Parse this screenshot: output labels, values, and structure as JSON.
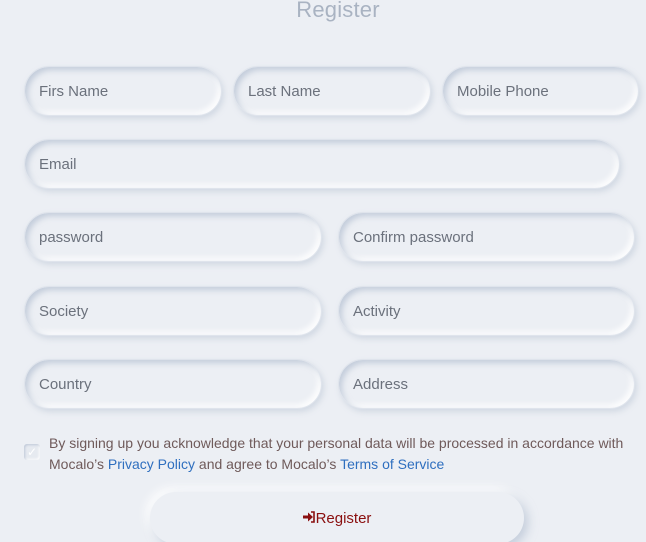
{
  "form": {
    "title": "Register",
    "fields": {
      "first_name": {
        "placeholder": "Firs Name",
        "value": ""
      },
      "last_name": {
        "placeholder": "Last Name",
        "value": ""
      },
      "mobile_phone": {
        "placeholder": "Mobile Phone",
        "value": ""
      },
      "email": {
        "placeholder": "Email",
        "value": ""
      },
      "password": {
        "placeholder": "password",
        "value": ""
      },
      "confirm_password": {
        "placeholder": "Confirm password",
        "value": ""
      },
      "society": {
        "placeholder": "Society",
        "value": ""
      },
      "activity": {
        "placeholder": "Activity",
        "value": ""
      },
      "country": {
        "placeholder": "Country",
        "value": ""
      },
      "address": {
        "placeholder": "Address",
        "value": ""
      }
    },
    "consent": {
      "text_before": "By signing up you acknowledge that your personal data will be processed in accordance with Mocalo’s ",
      "privacy_link": "Privacy Policy",
      "text_middle": " and agree to Mocalo’s ",
      "terms_link": "Terms of Service",
      "checked": true
    },
    "submit": {
      "label": "Register",
      "icon": "sign-in-icon"
    }
  },
  "colors": {
    "background": "#eceff4",
    "title": "#a9b3c2",
    "link": "#2f6fbf",
    "button_text": "#8a0f0f"
  }
}
